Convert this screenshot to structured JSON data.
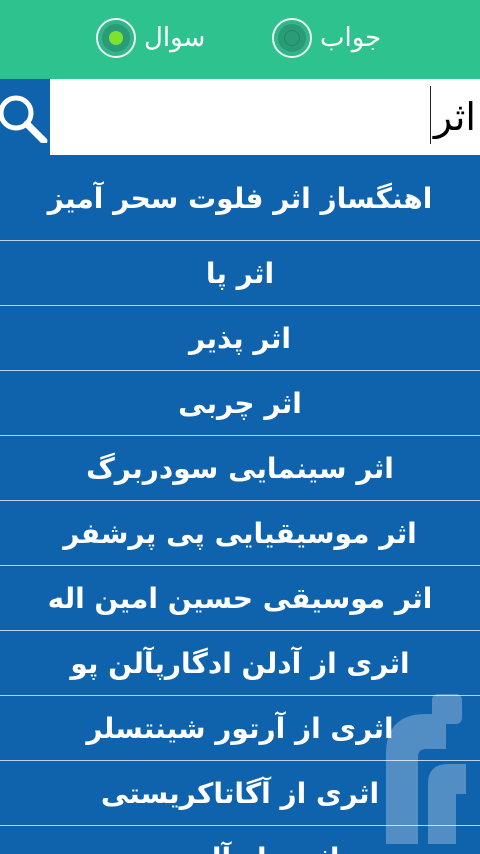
{
  "header": {
    "options": [
      {
        "label": "سوال",
        "selected": true
      },
      {
        "label": "جواب",
        "selected": false
      }
    ],
    "colors": {
      "bar": "#2ec28f",
      "selected_dot": "#7be32e",
      "unselected_dot": "#2a9b77"
    }
  },
  "search": {
    "value": "اثر",
    "button_icon": "search-icon"
  },
  "results": [
    "اهنگساز اثر فلوت سحر آمیز",
    "اثر پا",
    "اثر پذیر",
    "اثر چربی",
    "اثر سینمایی سودربرگ",
    "اثر موسیقیایی پی پرشفر",
    "اثر موسیقی حسین امین اله",
    "اثری از آدلن ادگارپآلن پو",
    "اثری از آرتور شینتسلر",
    "اثری از آگاتاکریستی",
    "اثری از آلبر ..."
  ]
}
